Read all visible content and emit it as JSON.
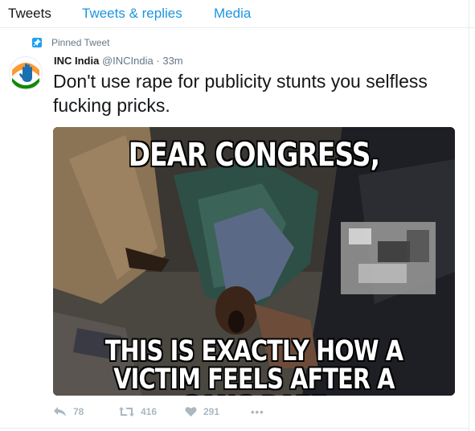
{
  "tabs": [
    {
      "label": "Tweets",
      "active": true
    },
    {
      "label": "Tweets & replies",
      "active": false
    },
    {
      "label": "Media",
      "active": false
    }
  ],
  "pinned_label": "Pinned Tweet",
  "tweet": {
    "name": "INC India",
    "handle": "@INCIndia",
    "separator": "·",
    "time": "33m",
    "text": "Don't use rape for publicity stunts you selfless fucking pricks.",
    "media": {
      "top_text": "DEAR CONGRESS,",
      "bottom_text_line1": "THIS IS EXACTLY HOW A",
      "bottom_text_line2": "VICTIM FEELS AFTER A GANG RAPE"
    },
    "actions": {
      "reply_count": "78",
      "retweet_count": "416",
      "like_count": "291",
      "more_label": "•••"
    }
  },
  "colors": {
    "link": "#1b95e0",
    "muted": "#657786",
    "action_gray": "#aab8c2",
    "border": "#e6ecf0",
    "avatar_saffron": "#ff9933",
    "avatar_green": "#138808"
  }
}
